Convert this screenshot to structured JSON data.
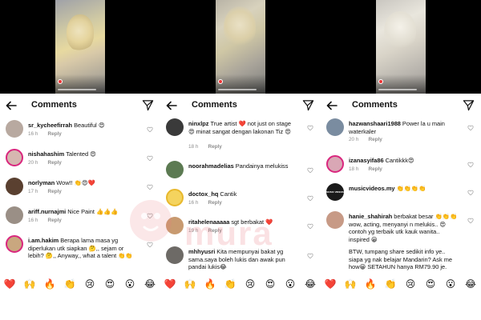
{
  "watermark_text": "mura",
  "panels": [
    {
      "title": "Comments",
      "comments": [
        {
          "user": "sr_kycheefirrah",
          "text": "Beautiful 😍",
          "time": "16 h",
          "reply": "Reply",
          "avatar_color": "#b8a9a0"
        },
        {
          "user": "nishahashim",
          "text": "Talented 😍",
          "time": "20 h",
          "reply": "Reply",
          "avatar_color": "#d6b7b0"
        },
        {
          "user": "norlyman",
          "text": "Wow!! 👏😍❤️",
          "time": "17 h",
          "reply": "Reply",
          "avatar_color": "#5a4030"
        },
        {
          "user": "ariff.nurnajmi",
          "text": "Nice Paint 👍👍👍",
          "time": "16 h",
          "reply": "Reply",
          "avatar_color": "#9a8f86"
        },
        {
          "user": "i.am.hakim",
          "text": "Berapa lama masa yg diperlukan utk siapkan 🤔,, sejam or lebih? 🤔,, Anyway,, what a talent 👏👏",
          "time": "",
          "reply": "",
          "avatar_color": "#c9a77f"
        }
      ],
      "reactions": [
        "❤️",
        "🙌",
        "🔥",
        "👏",
        "😢",
        "😍",
        "😮",
        "😂"
      ]
    },
    {
      "title": "Comments",
      "comments": [
        {
          "user": "ninxlpz",
          "text": "True artist ❤️ not just on stage 😍 minat sangat dengan lakonan Tiz 😍",
          "time": "18 h",
          "reply": "Reply",
          "avatar_color": "#3a3a3a"
        },
        {
          "user": "noorahmadelias",
          "text": "Pandainya melukiss",
          "time": "",
          "reply": "",
          "avatar_color": "#5c7a52"
        },
        {
          "user": "doctox_hq",
          "text": "Cantik",
          "time": "16 h",
          "reply": "Reply",
          "avatar_color": "#e8b82c"
        },
        {
          "user": "ritahelenaaaaa",
          "text": "sgt berbakat ❤️",
          "time": "19 h",
          "reply": "Reply",
          "avatar_color": "#c89a70"
        },
        {
          "user": "mhhyusri",
          "text": "Kita mempunyai bakat yg sama.saya boleh lukis dan awak pun pandai lukis😂",
          "time": "",
          "reply": "",
          "avatar_color": "#6d6a66"
        }
      ],
      "reactions": [
        "❤️",
        "🙌",
        "🔥",
        "👏",
        "😢",
        "😍",
        "😮",
        "😂"
      ]
    },
    {
      "title": "Comments",
      "comments": [
        {
          "user": "hazwanshaari1988",
          "text": "Power la u main waterkaler",
          "time": "20 h",
          "reply": "Reply",
          "avatar_color": "#7a8ca0"
        },
        {
          "user": "izanasyifa86",
          "text": "Cantikkk😍",
          "time": "18 h",
          "reply": "Reply",
          "avatar_color": "#d9a7b5"
        },
        {
          "user": "musicvideos.my",
          "text": "👏👏👏👏",
          "time": "",
          "reply": "",
          "avatar_color": "#1a1a1a",
          "avatar_label": "MUSIC VIDEOS"
        },
        {
          "user": "hanie_shahirah",
          "text": "berbakat besar 👏👏👏 wow, acting, menyanyi n melukis.. 😍 contoh yg terbaik utk kauk wanita.. inspired 😀",
          "time": "",
          "reply": "",
          "avatar_color": "#c79a86"
        },
        {
          "user": "",
          "text": "BTW, tumpang share sedikit info ye.. siapa yg nak belajar Mandarin? Ask me how😀 SETAHUN hanya RM79.90 je.",
          "time": "",
          "reply": "",
          "avatar_color": ""
        }
      ],
      "reactions": [
        "❤️",
        "🙌",
        "🔥",
        "👏",
        "😢",
        "😍",
        "😮",
        "😂"
      ]
    }
  ],
  "colors": {
    "heart_red": "#e0245e",
    "meta_gray": "#8e8e8e",
    "watermark": "#e87880"
  },
  "icons": {
    "back": "back-arrow-icon",
    "send": "send-icon",
    "like": "heart-outline-icon"
  }
}
